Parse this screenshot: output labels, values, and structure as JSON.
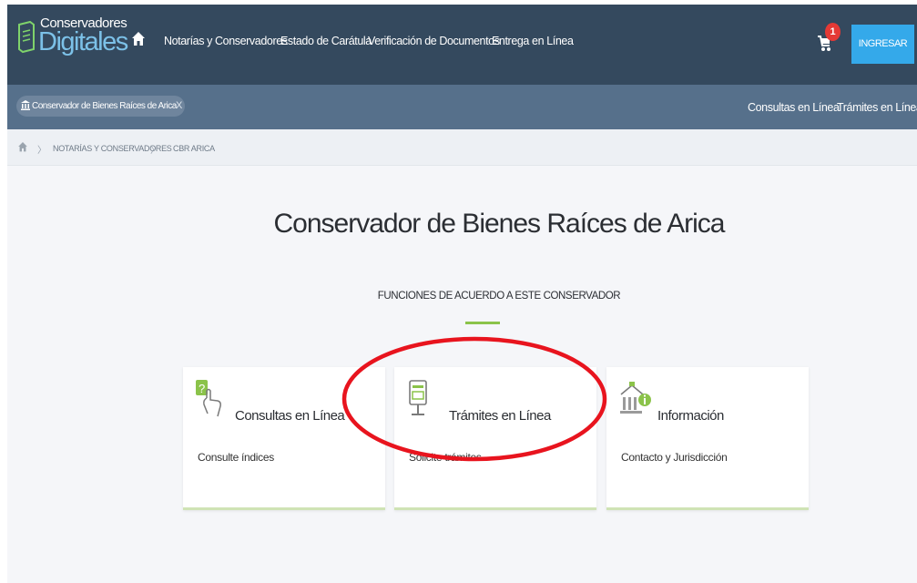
{
  "brand": {
    "line1": "Conservadores",
    "line2": "Digitales"
  },
  "nav": {
    "items": [
      {
        "label": "Notarías y Conservadores"
      },
      {
        "label": "Estado de Carátula"
      },
      {
        "label": "Verificación de Documentos"
      },
      {
        "label": "Entrega en Línea"
      }
    ],
    "cart_count": "1",
    "login_label": "INGRESAR"
  },
  "office_tab": {
    "label": "Conservador de Bienes Raíces de Arica",
    "close": "X"
  },
  "secondary_nav": {
    "consultas": "Consultas en Línea",
    "tramites": "Trámites en Línea"
  },
  "breadcrumb": {
    "items": [
      "NOTARÍAS Y CONSERVADORES",
      "CBR ARICA"
    ],
    "separator": "〉"
  },
  "main": {
    "title": "Conservador de Bienes Raíces de Arica",
    "subtitle": "FUNCIONES DE ACUERDO A ESTE CONSERVADOR",
    "cards": [
      {
        "title": "Consultas en Línea",
        "desc": "Consulte índices",
        "icon": "touch-search-icon"
      },
      {
        "title": "Trámites en Línea",
        "desc": "Solicite trámites",
        "icon": "kiosk-icon"
      },
      {
        "title": "Información",
        "desc": "Contacto y Jurisdicción",
        "icon": "building-info-icon"
      }
    ]
  },
  "colors": {
    "navbar": "#34495e",
    "secondary_bar": "#56708b",
    "accent_blue": "#34a9ea",
    "accent_green": "#8bc34a",
    "annotation_red": "#e8141e"
  }
}
